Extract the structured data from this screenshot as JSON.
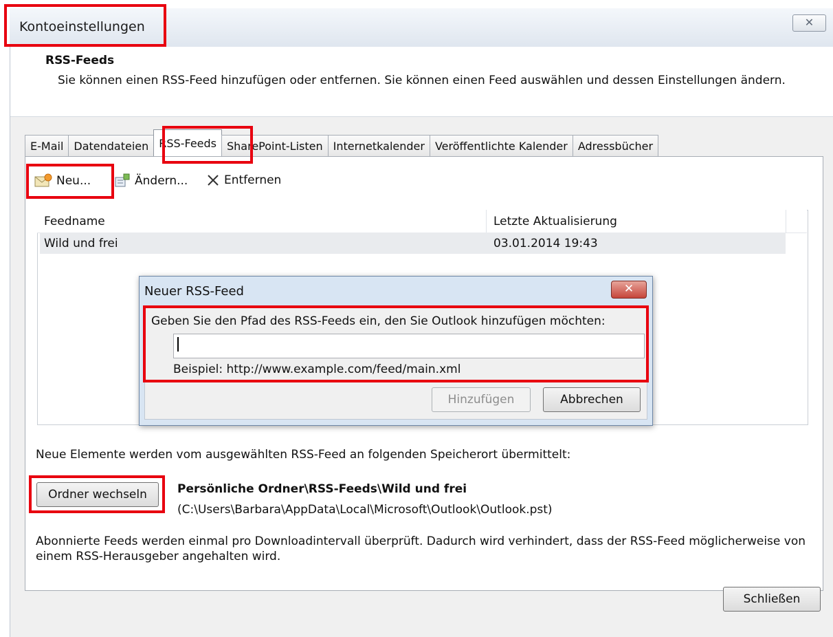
{
  "window": {
    "title": "Kontoeinstellungen",
    "close_glyph": "✕"
  },
  "section": {
    "title": "RSS-Feeds",
    "description": "Sie können einen RSS-Feed hinzufügen oder entfernen. Sie können einen Feed auswählen und dessen Einstellungen ändern."
  },
  "tabs": [
    {
      "label": "E-Mail"
    },
    {
      "label": "Datendateien"
    },
    {
      "label": "RSS-Feeds",
      "active": true
    },
    {
      "label": "SharePoint-Listen"
    },
    {
      "label": "Internetkalender"
    },
    {
      "label": "Veröffentlichte Kalender"
    },
    {
      "label": "Adressbücher"
    }
  ],
  "toolbar": {
    "new_label": "Neu...",
    "edit_label": "Ändern...",
    "remove_label": "Entfernen",
    "new_icon": "envelope-feed-icon",
    "edit_icon": "edit-properties-icon",
    "remove_icon": "x-icon"
  },
  "list": {
    "columns": [
      "Feedname",
      "Letzte Aktualisierung"
    ],
    "rows": [
      {
        "name": "Wild und frei",
        "updated": "03.01.2014 19:43"
      }
    ]
  },
  "dialog": {
    "title": "Neuer RSS-Feed",
    "close_glyph": "✕",
    "prompt": "Geben Sie den Pfad des RSS-Feeds ein, den Sie Outlook hinzufügen möchten:",
    "input_value": "",
    "example": "Beispiel: http://www.example.com/feed/main.xml",
    "add_label": "Hinzufügen",
    "cancel_label": "Abbrechen"
  },
  "delivery": {
    "info": "Neue Elemente werden vom ausgewählten RSS-Feed an folgenden Speicherort übermittelt:",
    "change_folder_label": "Ordner wechseln",
    "folder_path": "Persönliche Ordner\\RSS-Feeds\\Wild und frei",
    "file_path": "(C:\\Users\\Barbara\\AppData\\Local\\Microsoft\\Outlook\\Outlook.pst)",
    "note": "Abonnierte Feeds werden einmal pro Downloadintervall überprüft. Dadurch wird verhindert, dass der RSS-Feed möglicherweise von einem RSS-Herausgeber angehalten wird."
  },
  "footer": {
    "close_label": "Schließen"
  },
  "colors": {
    "highlight": "#e8000f",
    "dialog_frame": "#d8e5f3",
    "close_red": "#c6453a"
  }
}
